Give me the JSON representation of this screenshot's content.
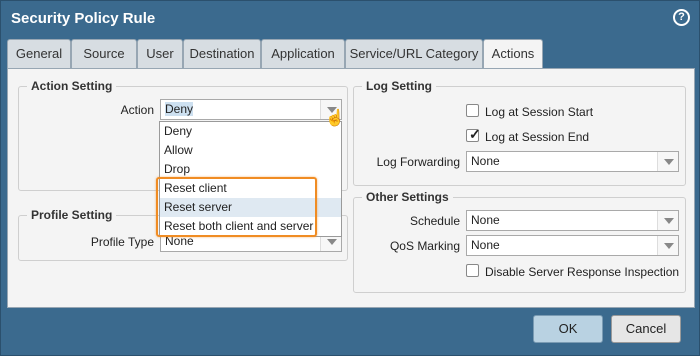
{
  "window": {
    "title": "Security Policy Rule",
    "help_glyph": "?"
  },
  "tabs": [
    {
      "label": "General"
    },
    {
      "label": "Source"
    },
    {
      "label": "User"
    },
    {
      "label": "Destination"
    },
    {
      "label": "Application"
    },
    {
      "label": "Service/URL Category"
    },
    {
      "label": "Actions"
    }
  ],
  "active_tab": "Actions",
  "action_setting": {
    "legend": "Action Setting",
    "action_label": "Action",
    "action_value": "Deny",
    "options": [
      "Deny",
      "Allow",
      "Drop",
      "Reset client",
      "Reset server",
      "Reset both client and server"
    ],
    "hovered_option": "Reset server",
    "highlight_color": "#f08c23"
  },
  "profile_setting": {
    "legend": "Profile Setting",
    "profile_type_label": "Profile Type",
    "profile_type_value": "None"
  },
  "log_setting": {
    "legend": "Log Setting",
    "log_at_session_start": {
      "label": "Log at Session Start",
      "checked": false
    },
    "log_at_session_end": {
      "label": "Log at Session End",
      "checked": true
    },
    "log_forwarding_label": "Log Forwarding",
    "log_forwarding_value": "None"
  },
  "other_settings": {
    "legend": "Other Settings",
    "schedule_label": "Schedule",
    "schedule_value": "None",
    "qos_label": "QoS Marking",
    "qos_value": "None",
    "disable_srv_resp": {
      "label": "Disable Server Response Inspection",
      "checked": false
    }
  },
  "buttons": {
    "ok": "OK",
    "cancel": "Cancel"
  },
  "colors": {
    "titlebar": "#3b6a8e",
    "panel": "#f4f4f4",
    "ok_button": "#b9d2e2"
  },
  "check_glyph": "✓"
}
